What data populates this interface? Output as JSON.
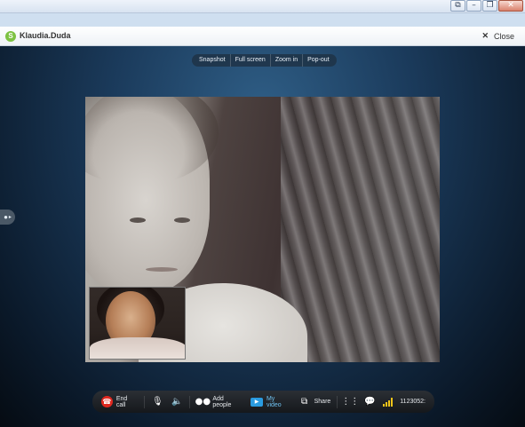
{
  "window": {
    "buttons": [
      {
        "name": "restore-small",
        "glyph": "⧉"
      },
      {
        "name": "minimize",
        "glyph": "–"
      },
      {
        "name": "maximize",
        "glyph": "❐"
      },
      {
        "name": "close",
        "glyph": "✕"
      }
    ]
  },
  "header": {
    "icon": "skype-icon",
    "contact_name": "Klaudia.Duda",
    "close_label": "Close"
  },
  "top_controls": [
    "Snapshot",
    "Full screen",
    "Zoom in",
    "Pop-out"
  ],
  "side_tab": {
    "icon": "person-icon",
    "glyph": "👤"
  },
  "toolbar": {
    "end_call_label": "End call",
    "add_people_label": "Add people",
    "my_video_label": "My video",
    "share_label": "Share",
    "timer_text": "1123052:"
  },
  "colors": {
    "end_call": "#e0281f",
    "my_video_accent": "#6fc1f0",
    "signal": "#f0c419",
    "stage_top": "#2f5e86"
  }
}
